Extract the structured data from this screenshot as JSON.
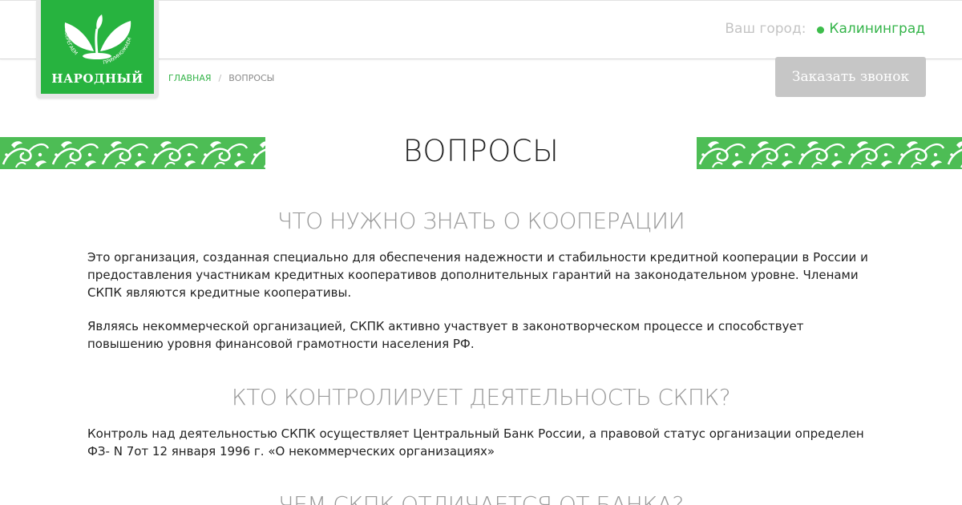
{
  "header": {
    "city_label": "Ваш город:",
    "city_name": "Калининград",
    "callback_label": "Заказать звонок"
  },
  "logo": {
    "name": "НАРОДНЫЙ",
    "tagline_left": "СБЕРЕГАЕМ",
    "tagline_right": "ПРИУМНОЖАЕМ"
  },
  "breadcrumb": {
    "home": "ГЛАВНАЯ",
    "separator": "/",
    "current": "ВОПРОСЫ"
  },
  "page_title": "ВОПРОСЫ",
  "sections": [
    {
      "title": "ЧТО НУЖНО ЗНАТЬ О КООПЕРАЦИИ",
      "paragraphs": [
        "Это организация, созданная специально для обеспечения надежности и стабильности кредитной кооперации в России и предоставления участникам кредитных кооперативов дополнительных гарантий на законодательном уровне. Членами СКПК являются кредитные кооперативы.",
        "Являясь некоммерческой организацией, СКПК активно участвует в законотворческом процессе и способствует повышению уровня финансовой грамотности населения РФ."
      ]
    },
    {
      "title": "КТО КОНТРОЛИРУЕТ ДЕЯТЕЛЬНОСТЬ СКПК?",
      "paragraphs": [
        "Контроль над деятельностью СКПК осуществляет Центральный Банк России, а правовой статус организации определен ФЗ- N 7от 12 января 1996 г. «О некоммерческих организациях»"
      ]
    },
    {
      "title": "ЧЕМ СКПК ОТЛИЧАЕТСЯ ОТ БАНКА?",
      "paragraphs": []
    }
  ],
  "colors": {
    "brand_green": "#27b33f",
    "link_green": "#35b44a",
    "ornament_green": "#4dbd55",
    "button_gray": "#c6c6c6"
  }
}
